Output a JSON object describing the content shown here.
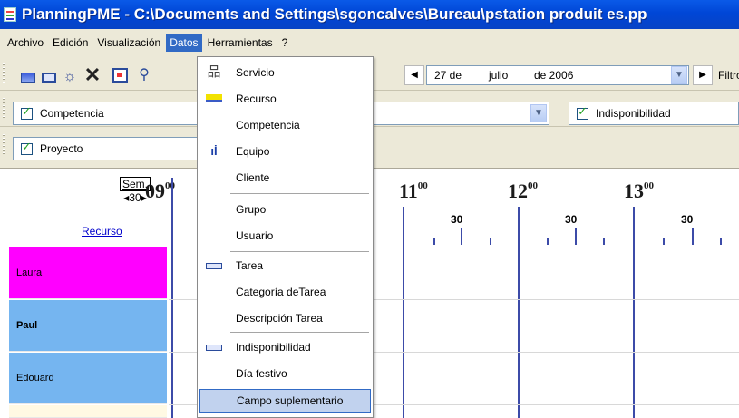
{
  "window": {
    "title": "PlanningPME - C:\\Documents and Settings\\sgoncalves\\Bureau\\pstation produit es.pp"
  },
  "menubar": [
    "Archivo",
    "Edición",
    "Visualización",
    "Datos",
    "Herramientas",
    "?"
  ],
  "datos_menu": [
    {
      "label": "Servicio",
      "icon": "org-chart-icon"
    },
    {
      "label": "Recurso",
      "icon": "resource-icon"
    },
    {
      "label": "Competencia",
      "icon": ""
    },
    {
      "label": "Equipo",
      "icon": "team-icon"
    },
    {
      "label": "Cliente",
      "icon": ""
    },
    {
      "label": "Grupo",
      "icon": ""
    },
    {
      "label": "Usuario",
      "icon": ""
    },
    {
      "label": "Tarea",
      "icon": "task-icon"
    },
    {
      "label": "Categoría deTarea",
      "icon": ""
    },
    {
      "label": "Descripción Tarea",
      "icon": ""
    },
    {
      "label": "Indisponibilidad",
      "icon": "unavailability-icon"
    },
    {
      "label": "Día festivo",
      "icon": ""
    },
    {
      "label": "Campo suplementario",
      "icon": "",
      "highlighted": true
    }
  ],
  "date_picker": {
    "day": "27 de",
    "month": "julio",
    "year": "de 2006"
  },
  "filter_label": "Filtro:",
  "filters": {
    "competencia": "Competencia",
    "indisponibilidad": "Indisponibilidad",
    "proyecto": "Proyecto"
  },
  "schedule": {
    "sem_label": "Sem.",
    "sem_value": "30",
    "recurso_link": "Recurso",
    "hours": [
      {
        "h": "09",
        "m": "00"
      },
      {
        "h": "11",
        "m": "00"
      },
      {
        "h": "12",
        "m": "00"
      },
      {
        "h": "13",
        "m": "00"
      }
    ],
    "half_label": "30",
    "resources": [
      {
        "name": "Laura",
        "color": "#ff00ff",
        "bold": false
      },
      {
        "name": "Paul",
        "color": "#75b5f0",
        "bold": true
      },
      {
        "name": "Edouard",
        "color": "#75b5f0",
        "bold": false
      }
    ]
  }
}
